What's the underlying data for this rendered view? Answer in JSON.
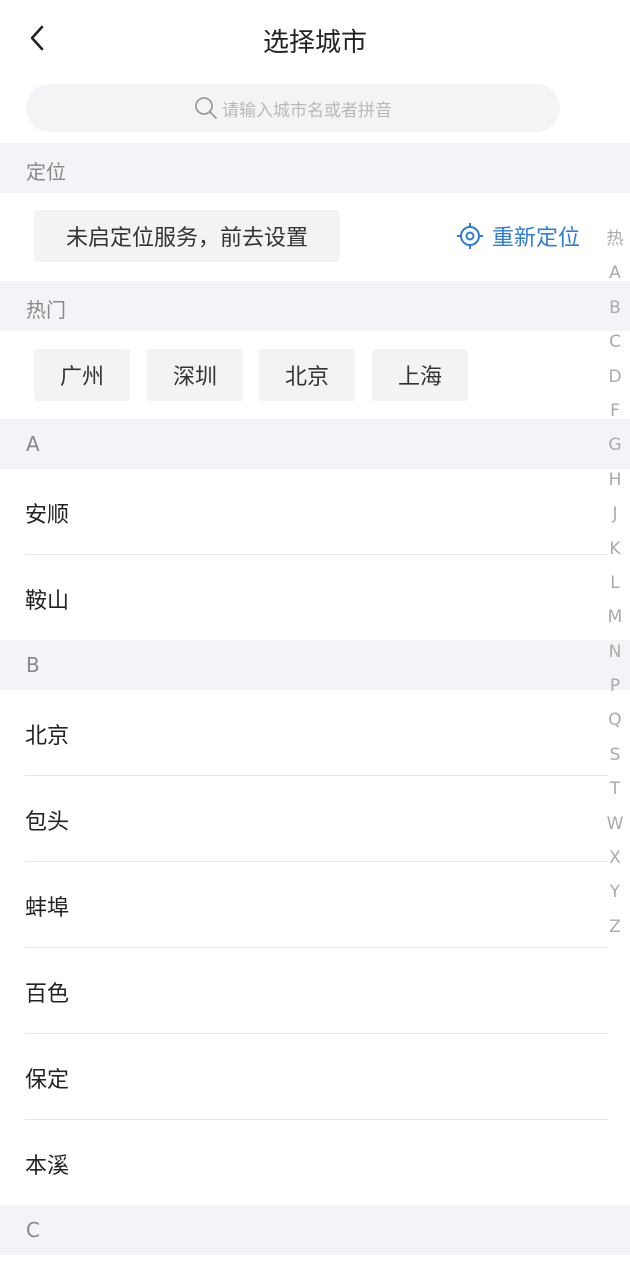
{
  "header": {
    "title": "选择城市"
  },
  "search": {
    "placeholder": "请输入城市名或者拼音"
  },
  "sections": {
    "location": "定位",
    "hot": "热门",
    "a": "A",
    "b": "B",
    "c": "C"
  },
  "location": {
    "status": "未启定位服务，前去设置",
    "relocate": "重新定位"
  },
  "hot_cities": [
    "广州",
    "深圳",
    "北京",
    "上海"
  ],
  "city_groups": {
    "A": [
      "安顺",
      "鞍山"
    ],
    "B": [
      "北京",
      "包头",
      "蚌埠",
      "百色",
      "保定",
      "本溪"
    ]
  },
  "index_letters": [
    "热",
    "A",
    "B",
    "C",
    "D",
    "F",
    "G",
    "H",
    "J",
    "K",
    "L",
    "M",
    "N",
    "P",
    "Q",
    "S",
    "T",
    "W",
    "X",
    "Y",
    "Z"
  ],
  "colors": {
    "accent": "#2f7dd6",
    "section_bg": "#f4f4f8",
    "chip_bg": "#f3f3f5"
  },
  "icons": {
    "back": "chevron-left-icon",
    "search": "search-icon",
    "locate": "locate-icon"
  }
}
